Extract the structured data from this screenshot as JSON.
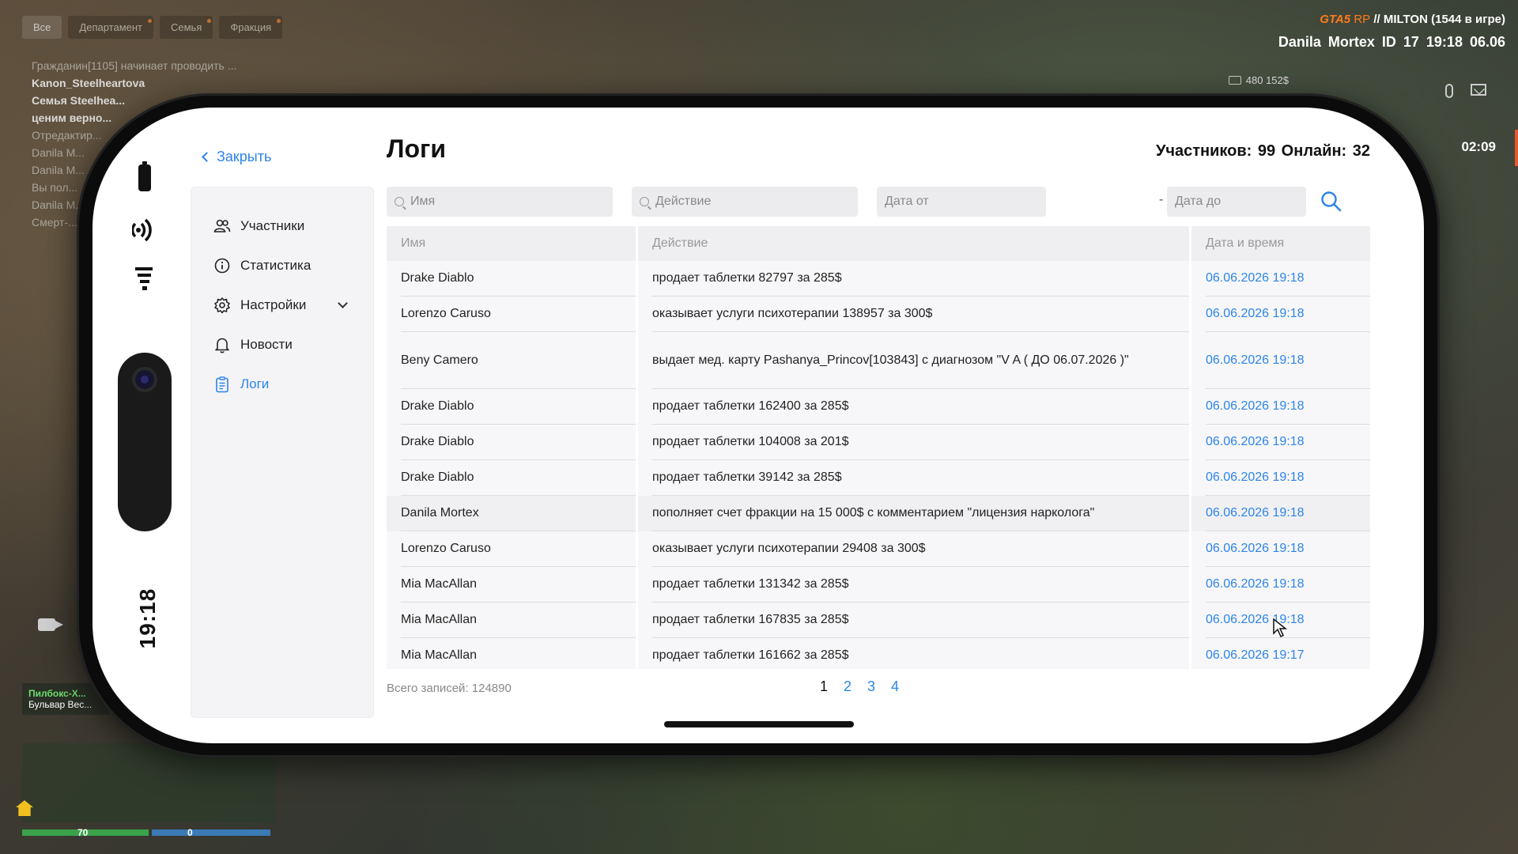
{
  "hud": {
    "chat_tabs": [
      {
        "label": "Все",
        "active": true
      },
      {
        "label": "Департамент",
        "active": false
      },
      {
        "label": "Семья",
        "active": false
      },
      {
        "label": "Фракция",
        "active": false
      }
    ],
    "chat_lines": [
      {
        "text": "Гражданин[1105] начинает проводить ...",
        "bold": false
      },
      {
        "text": "Kanon_Steelheartova",
        "bold": true
      },
      {
        "text": "Семья Steelhea...",
        "bold": true
      },
      {
        "text": "ценим верно...",
        "bold": true
      },
      {
        "text": "Отредактир...",
        "bold": false
      },
      {
        "text": "Danila M...",
        "bold": false
      },
      {
        "text": "Danila M...",
        "bold": false
      },
      {
        "text": "Вы пол...",
        "bold": false
      },
      {
        "text": "Danila M...",
        "bold": false
      },
      {
        "text": "Смерт-...",
        "bold": false
      }
    ],
    "server_brand": "GTA5",
    "server_rp": "RP",
    "server_name": "// MILTON (1544 в игре)",
    "player_line": "Danila Mortex   ID 17   19:18   06.06",
    "money": "480 152$",
    "timer": "02:09",
    "location_zone": "Пилбокс-Х...",
    "location_street": "Бульвар Вес...",
    "health": "70",
    "armor": "0"
  },
  "phone": {
    "side_time": "19:18",
    "close_label": "Закрыть",
    "title": "Логи",
    "stats": "Участников: 99  Онлайн: 32",
    "nav": [
      {
        "label": "Участники",
        "icon": "users-icon",
        "active": false
      },
      {
        "label": "Статистика",
        "icon": "info-icon",
        "active": false
      },
      {
        "label": "Настройки",
        "icon": "gear-icon",
        "active": false
      },
      {
        "label": "Новости",
        "icon": "bell-icon",
        "active": false
      },
      {
        "label": "Логи",
        "icon": "clipboard-icon",
        "active": true
      }
    ],
    "filters": {
      "name_placeholder": "Имя",
      "action_placeholder": "Действие",
      "date_from_placeholder": "Дата от",
      "date_to_placeholder": "Дата до",
      "separator": "-"
    },
    "table": {
      "headers": [
        "Имя",
        "Действие",
        "Дата и время"
      ],
      "rows": [
        {
          "name": "Drake Diablo",
          "action": "продает таблетки 82797 за 285$",
          "date": "06.06.2026 19:18"
        },
        {
          "name": "Lorenzo Caruso",
          "action": "оказывает услуги психотерапии 138957 за 300$",
          "date": "06.06.2026 19:18"
        },
        {
          "name": "Beny Camero",
          "action": "выдает мед. карту Pashanya_Princov[103843] с диагнозом \"V A ( ДО 06.07.2026 )\"",
          "date": "06.06.2026 19:18"
        },
        {
          "name": "Drake Diablo",
          "action": "продает таблетки 162400 за 285$",
          "date": "06.06.2026 19:18"
        },
        {
          "name": "Drake Diablo",
          "action": "продает таблетки 104008 за 201$",
          "date": "06.06.2026 19:18"
        },
        {
          "name": "Drake Diablo",
          "action": "продает таблетки 39142 за 285$",
          "date": "06.06.2026 19:18"
        },
        {
          "name": "Danila Mortex",
          "action": "пополняет счет фракции на 15 000$ с комментарием \"лицензия нарколога\"",
          "date": "06.06.2026 19:18"
        },
        {
          "name": "Lorenzo Caruso",
          "action": "оказывает услуги психотерапии 29408 за 300$",
          "date": "06.06.2026 19:18"
        },
        {
          "name": "Mia MacAllan",
          "action": "продает таблетки 131342 за 285$",
          "date": "06.06.2026 19:18"
        },
        {
          "name": "Mia MacAllan",
          "action": "продает таблетки 167835 за 285$",
          "date": "06.06.2026 19:18"
        },
        {
          "name": "Mia MacAllan",
          "action": "продает таблетки 161662 за 285$",
          "date": "06.06.2026 19:17"
        }
      ]
    },
    "total": "Всего записей: 124890",
    "pages": [
      "1",
      "2",
      "3",
      "4"
    ],
    "current_page": "1"
  }
}
